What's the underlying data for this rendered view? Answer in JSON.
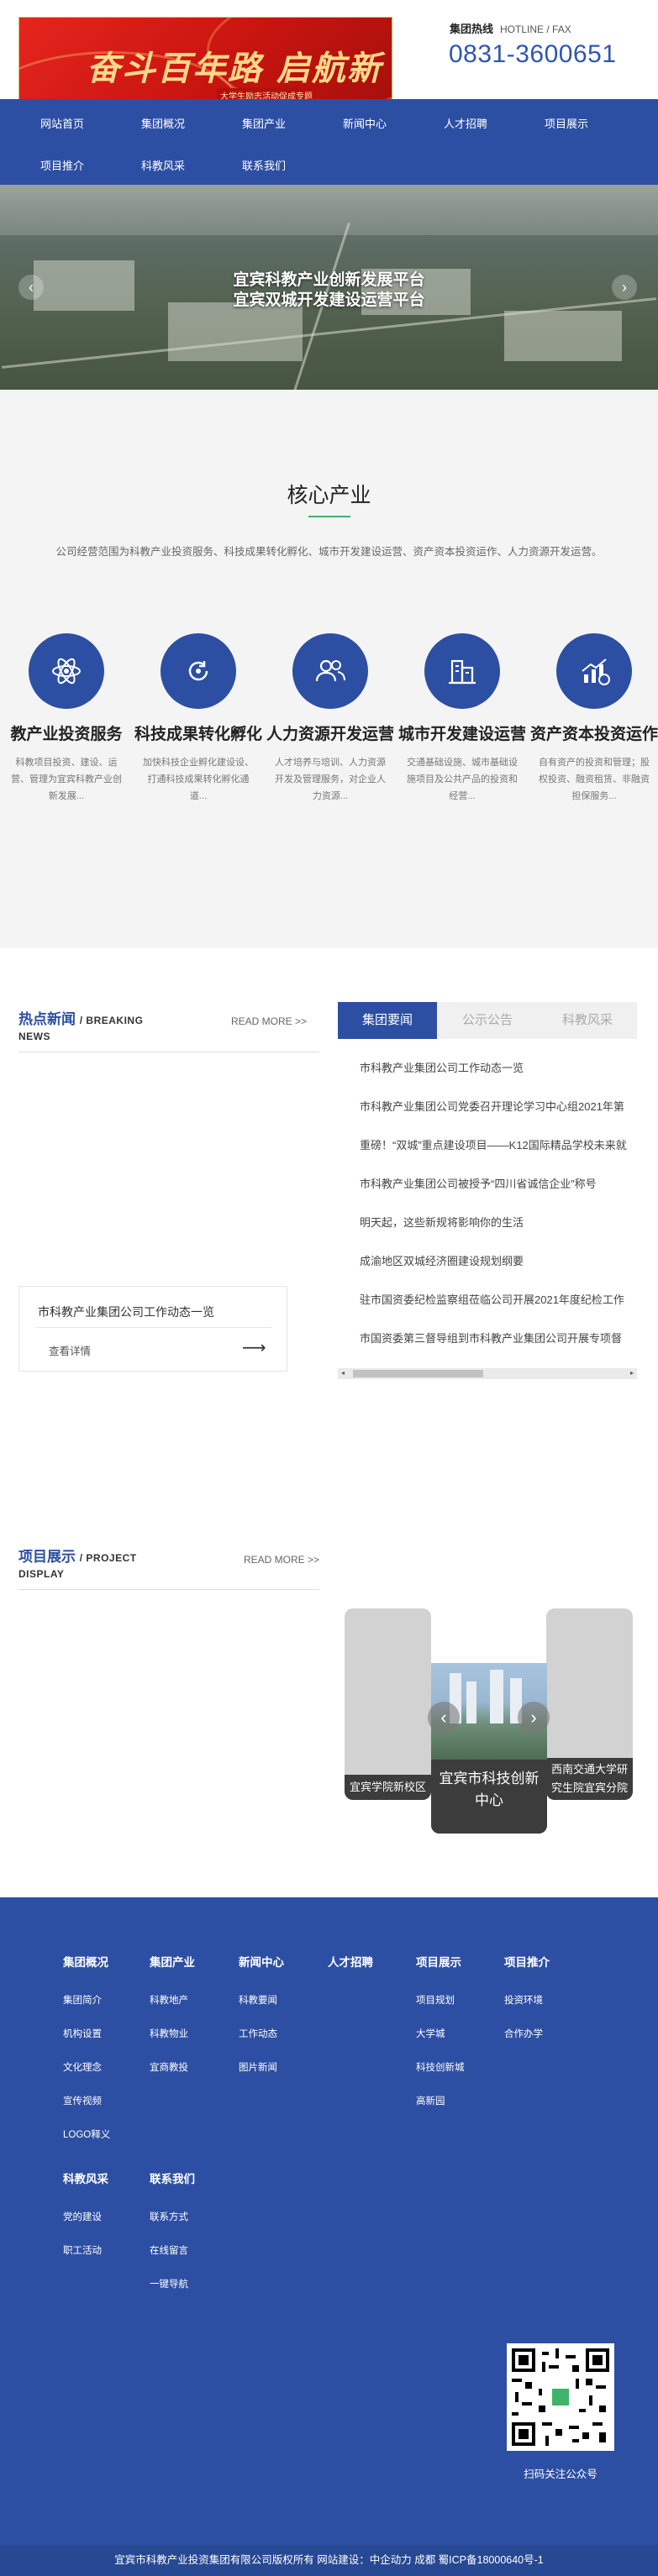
{
  "header": {
    "banner_slogan": "奋斗百年路  启航新征程",
    "banner_sub": "大学生励志活动促成专题",
    "hotline_label": "集团热线",
    "hotline_en": "HOTLINE / FAX",
    "phone": "0831-3600651"
  },
  "nav": {
    "items": [
      "网站首页",
      "集团概况",
      "集团产业",
      "新闻中心",
      "人才招聘",
      "项目展示",
      "项目推介",
      "科教风采",
      "联系我们"
    ]
  },
  "hero": {
    "line1": "宜宾科教产业创新发展平台",
    "line2": "宜宾双城开发建设运营平台",
    "prev": "‹",
    "next": "›"
  },
  "core": {
    "title": "核心产业",
    "intro": "公司经营范围为科教产业投资服务、科技成果转化孵化、城市开发建设运营、资产资本投资运作、人力资源开发运营。",
    "industries": [
      {
        "name": "教产业投资服务",
        "desc": "科教项目投资、建设、运营、管理为宜宾科教产业创新发展..."
      },
      {
        "name": "科技成果转化孵化",
        "desc": "加快科技企业孵化建设设、打通科技成果转化孵化通道..."
      },
      {
        "name": "人力资源开发运营",
        "desc": "人才培养与培训、人力资源开发及管理服务，对企业人力资源..."
      },
      {
        "name": "城市开发建设运营",
        "desc": "交通基础设施、城市基础设施项目及公共产品的投资和经营..."
      },
      {
        "name": "资产资本投资运作",
        "desc": "自有资产的投资和管理；股权投资、融资租赁、非融资担保服务..."
      }
    ]
  },
  "news": {
    "title": "热点新闻",
    "title_en": "/ BREAKING NEWS",
    "more": "READ MORE >>",
    "card_title": "市科教产业集团公司工作动态一览",
    "card_link": "查看详情",
    "card_arrow": "⟶",
    "tabs": [
      "集团要闻",
      "公示公告",
      "科教风采"
    ],
    "items": [
      "市科教产业集团公司工作动态一览",
      "市科教产业集团公司党委召开理论学习中心组2021年第",
      "重磅！“双城”重点建设项目——K12国际精品学校未来就",
      "市科教产业集团公司被授予“四川省诚信企业”称号",
      "明天起，这些新规将影响你的生活",
      "成渝地区双城经济圈建设规划纲要",
      "驻市国资委纪检监察组莅临公司开展2021年度纪检工作",
      "市国资委第三督导组到市科教产业集团公司开展专项督"
    ],
    "scroll_left": "◂",
    "scroll_right": "▸"
  },
  "projects": {
    "title": "项目展示",
    "title_en": "/ PROJECT DISPLAY",
    "more": "READ MORE >>",
    "cards": [
      {
        "caption": "宜宾学院新校区"
      },
      {
        "caption": "宜宾市科技创新中心"
      },
      {
        "caption": "西南交通大学研究生院宜宾分院"
      }
    ],
    "prev": "‹",
    "next": "›"
  },
  "footer": {
    "columns": [
      {
        "head": "集团概况",
        "links": [
          "集团简介",
          "机构设置",
          "文化理念",
          "宣传视频",
          "LOGO释义"
        ]
      },
      {
        "head": "集团产业",
        "links": [
          "科教地产",
          "科教物业",
          "宜商教投"
        ]
      },
      {
        "head": "新闻中心",
        "links": [
          "科教要闻",
          "工作动态",
          "图片新闻"
        ]
      },
      {
        "head": "人才招聘",
        "links": []
      },
      {
        "head": "项目展示",
        "links": [
          "项目规划",
          "大学城",
          "科技创新城",
          "高新园"
        ]
      },
      {
        "head": "项目推介",
        "links": [
          "投资环境",
          "合作办学"
        ]
      },
      {
        "head": "科教风采",
        "links": [
          "党的建设",
          "职工活动"
        ]
      },
      {
        "head": "联系我们",
        "links": [
          "联系方式",
          "在线留言",
          "一键导航"
        ]
      }
    ],
    "qr_caption": "扫码关注公众号",
    "copyright": "宜宾市科教产业投资集团有限公司版权所有 网站建设：中企动力 成都    蜀ICP备18000640号-1"
  },
  "colors": {
    "primary": "#2d4fa3",
    "accent_green": "#3fb36b",
    "banner_red": "#e5251e"
  }
}
